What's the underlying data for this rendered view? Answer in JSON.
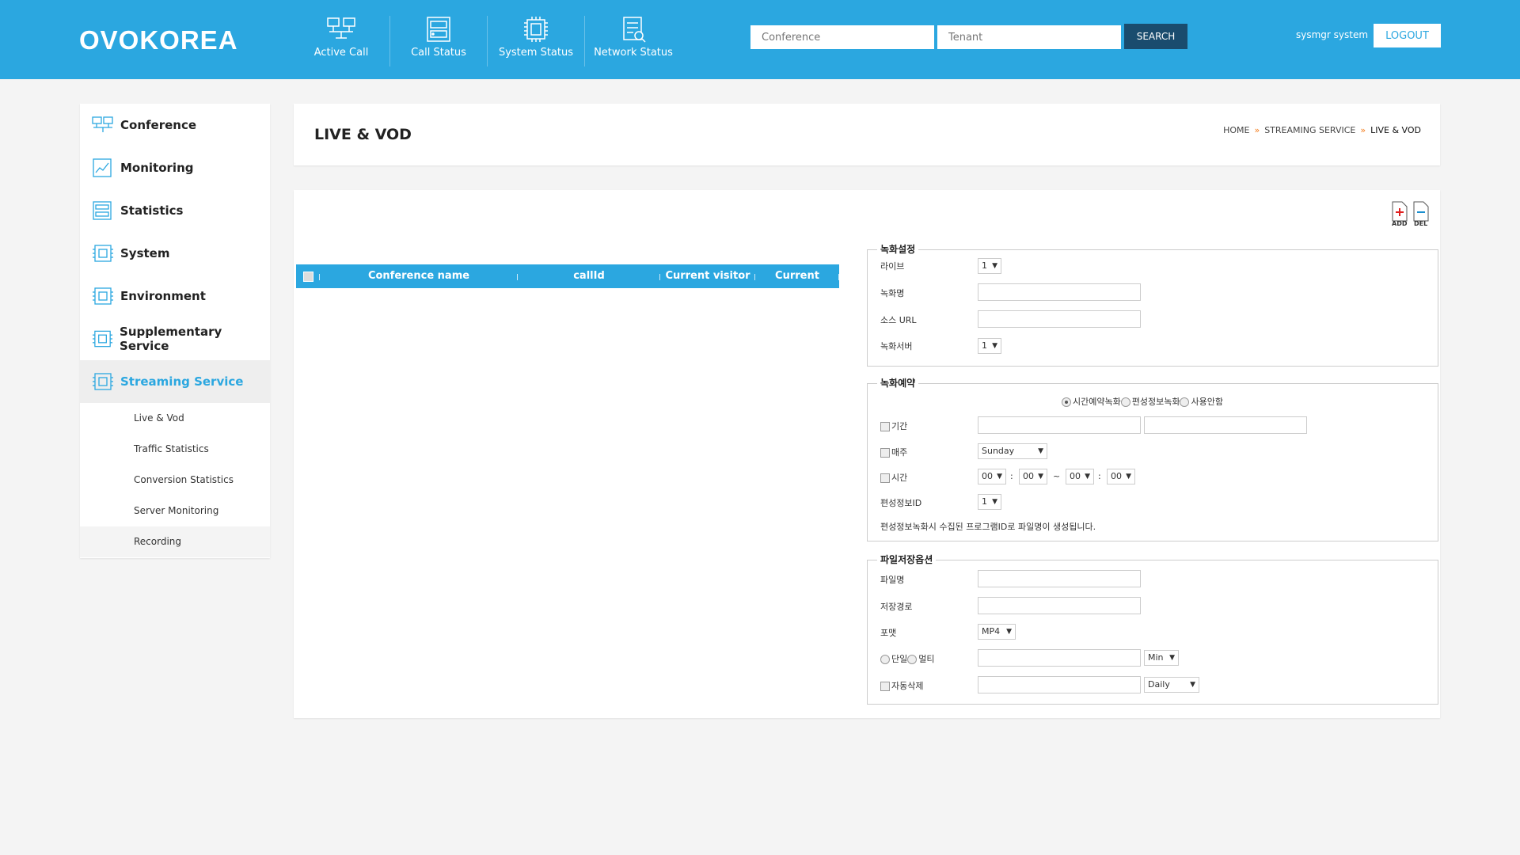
{
  "header": {
    "logo": "OVOKOREA",
    "nav": [
      {
        "label": "Active Call",
        "icon": "network-monitors-icon"
      },
      {
        "label": "Call Status",
        "icon": "server-icon"
      },
      {
        "label": "System Status",
        "icon": "chip-icon"
      },
      {
        "label": "Network Status",
        "icon": "search-list-icon"
      }
    ],
    "search": {
      "conference_placeholder": "Conference",
      "tenant_placeholder": "Tenant",
      "button": "SEARCH"
    },
    "user": "sysmgr system",
    "logout": "LOGOUT"
  },
  "sidebar": {
    "items": [
      {
        "label": "Conference",
        "icon": "monitors-icon"
      },
      {
        "label": "Monitoring",
        "icon": "chart-icon"
      },
      {
        "label": "Statistics",
        "icon": "server-icon"
      },
      {
        "label": "System",
        "icon": "chip-icon"
      },
      {
        "label": "Environment",
        "icon": "chip-icon"
      },
      {
        "label": "Supplementary Service",
        "icon": "chip-icon"
      },
      {
        "label": "Streaming Service",
        "icon": "chip-icon",
        "active": true
      }
    ],
    "subitems": [
      "Live & Vod",
      "Traffic Statistics",
      "Conversion Statistics",
      "Server Monitoring",
      "Recording"
    ]
  },
  "page": {
    "title": "LIVE & VOD",
    "breadcrumb": [
      "HOME",
      "STREAMING SERVICE",
      "LIVE & VOD"
    ],
    "add_label": "ADD",
    "del_label": "DEL"
  },
  "table": {
    "columns": [
      "Conference name",
      "callId",
      "Current visitor",
      "Current visitor"
    ]
  },
  "recording_settings": {
    "legend": "녹화설정",
    "live_label": "라이브",
    "live_value": "1",
    "name_label": "녹화명",
    "source_label": "소스 URL",
    "server_label": "녹화서버",
    "server_value": "1"
  },
  "recording_schedule": {
    "legend": "녹화예약",
    "mode_options": [
      "시간예약녹화",
      "편성정보녹화",
      "사용안함"
    ],
    "period_label": "기간",
    "weekly_label": "매주",
    "weekly_value": "Sunday",
    "time_label": "시간",
    "time_values": [
      "00",
      "00",
      "00",
      "00"
    ],
    "time_sep": ":",
    "range_sep": "~",
    "schedule_id_label": "편성정보ID",
    "schedule_id_value": "1",
    "note": "편성정보녹화시 수집된 프로그램ID로 파일명이 생성됩니다."
  },
  "file_options": {
    "legend": "파일저장옵션",
    "filename_label": "파일명",
    "path_label": "저장경로",
    "format_label": "포맷",
    "format_value": "MP4",
    "single_label": "단일",
    "multi_label": "멀티",
    "unit_value": "Min",
    "auto_delete_label": "자동삭제",
    "auto_delete_value": "Daily"
  }
}
